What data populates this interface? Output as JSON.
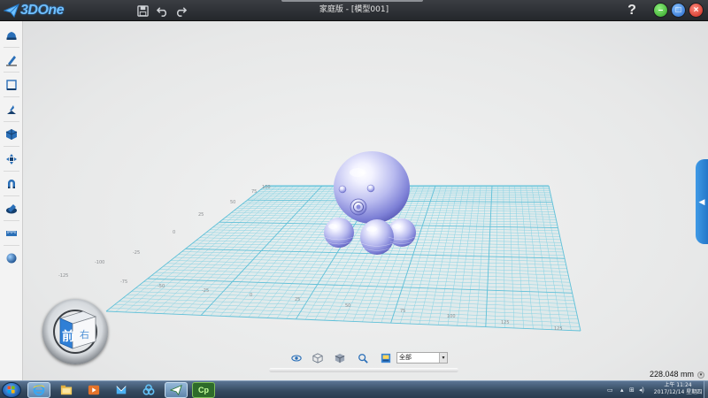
{
  "app": {
    "logo_text": "3DOne",
    "window_title": "家庭版 - [模型001]",
    "help_label": "?",
    "brand_color": "#3d8fe0"
  },
  "title_toolbar": {
    "icons": [
      "save-icon",
      "undo-icon",
      "redo-icon"
    ]
  },
  "window_controls": [
    "minimize",
    "maximize",
    "close"
  ],
  "left_toolbar": {
    "tools": [
      "basic-solid-icon",
      "sketch-pen-icon",
      "sketch-edit-icon",
      "feature-modeling-icon",
      "special-function-icon",
      "basic-edit-icon",
      "combine-magnet-icon",
      "color-paint-icon",
      "measure-icon",
      "material-ball-icon"
    ]
  },
  "viewport": {
    "grid_color": "#7fd3e6",
    "model_color": "#b7b9ee",
    "axis_labels": {
      "x": [
        "-125",
        "-100",
        "-75",
        "-50",
        "-25",
        "0",
        "25",
        "50",
        "75",
        "100",
        "125"
      ],
      "left": [
        "-125",
        "-100",
        "-75",
        "-50",
        "-25",
        "0",
        "25",
        "50",
        "75",
        "100",
        "125"
      ]
    }
  },
  "view_cube": {
    "face_label": "前",
    "side_label": "右"
  },
  "view_toolbar": {
    "icons": [
      "view-eye-icon",
      "view-isometric-icon",
      "view-cube-icon",
      "view-zoom-icon",
      "view-render-icon"
    ],
    "select_value": "全部"
  },
  "status": {
    "grid_size": "228.048 mm"
  },
  "taskbar": {
    "apps": [
      "ie-icon",
      "explorer-icon",
      "media-player-icon",
      "feishu-icon",
      "app-icon",
      "3done-taskbar-icon",
      "captivate-icon"
    ],
    "cp_label": "Cp",
    "clock_time": "上午 11:24",
    "clock_date": "2017/12/14 星期四"
  }
}
